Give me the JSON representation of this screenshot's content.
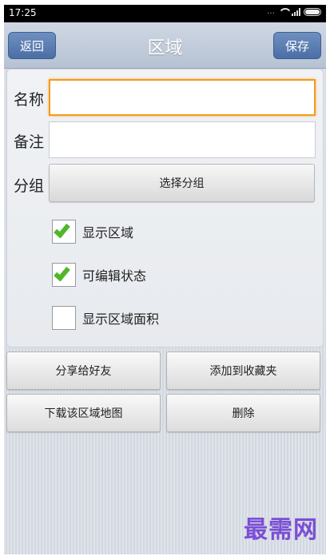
{
  "status_bar": {
    "time": "17:25",
    "icons": [
      "dots-icon",
      "wifi-icon",
      "signal-icon",
      "battery-icon"
    ]
  },
  "header": {
    "back_label": "返回",
    "title": "区域",
    "save_label": "保存"
  },
  "form": {
    "name_label": "名称",
    "name_value": "",
    "note_label": "备注",
    "note_value": "",
    "group_label": "分组",
    "group_button": "选择分组",
    "options": [
      {
        "label": "显示区域",
        "checked": true
      },
      {
        "label": "可编辑状态",
        "checked": true
      },
      {
        "label": "显示区域面积",
        "checked": false
      }
    ]
  },
  "actions": {
    "share": "分享给好友",
    "favorite": "添加到收藏夹",
    "download_map": "下载该区域地图",
    "delete": "删除"
  },
  "watermark": "最需网",
  "colors": {
    "accent": "#4a6fa5",
    "focus": "#f39a1c",
    "check": "#4fb82a"
  }
}
